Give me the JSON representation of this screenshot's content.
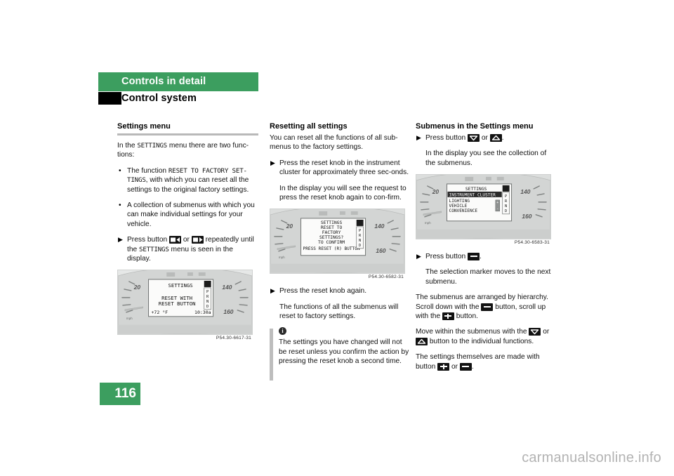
{
  "header": {
    "chapter": "Controls in detail",
    "section": "Control system"
  },
  "page_number": "116",
  "watermark": "carmanualsonline.info",
  "colors": {
    "brand_green": "#3c9e5f",
    "rule_gray": "#b9b9b9",
    "note_bar_gray": "#bdbdbd"
  },
  "columns": {
    "left": {
      "heading": "Settings menu",
      "intro_a": "In the ",
      "intro_code": "SETTINGS",
      "intro_b": " menu there are two func-tions:",
      "bullet1_a": "The function ",
      "bullet1_code": "RESET TO FACTORY SET-TINGS",
      "bullet1_b": ", with which you can reset all the settings to the original factory settings.",
      "bullet2": "A collection of submenus with which you can make individual settings for your vehicle.",
      "step_a": "Press button",
      "step_or": "or",
      "step_b": "repeatedly until the",
      "step_code": "SETTINGS",
      "step_c": "menu is seen in the display.",
      "figure": {
        "caption": "P54.30-6617-31",
        "display_title": "SETTINGS",
        "display_line1": "RESET WITH",
        "display_line2": "RESET BUTTON",
        "temp": "+72 °F",
        "clock": "10:30a",
        "gear_letters": "PRND",
        "left_scale": "20",
        "right_scale_top": "140",
        "right_scale_bottom": "160",
        "unit": "mph"
      }
    },
    "middle": {
      "heading": "Resetting all settings",
      "intro": "You can reset all the functions of all sub-menus to the factory settings.",
      "step1": "Press the reset knob in the instrument cluster for approximately three sec-onds.",
      "step1_result": "In the display you will see the request to press the reset knob again to con-firm.",
      "figure": {
        "caption": "P54.30-6582-31",
        "display_title": "SETTINGS",
        "display_line1": "RESET TO",
        "display_line2": "FACTORY",
        "display_line3": "SETTINGS?",
        "display_line4": "TO CONFIRM",
        "display_line5": "PRESS RESET (R) BUTTON",
        "gear_letters": "PRND",
        "left_scale": "20",
        "right_scale_top": "140",
        "right_scale_bottom": "160",
        "unit": "mph"
      },
      "step2": "Press the reset knob again.",
      "step2_result": "The functions of all the submenus will reset to factory settings.",
      "note_icon": "i",
      "note": "The settings you have changed will not be reset unless you confirm the action by pressing the reset knob a second time."
    },
    "right": {
      "heading": "Submenus in the Settings menu",
      "step1_a": "Press button",
      "step1_or": "or",
      "step1_end": ".",
      "step1_result": "In the display you see the collection of the submenus.",
      "figure": {
        "caption": "P54.30-6583-31",
        "display_title": "SETTINGS",
        "menu_items": [
          "INSTRUMENT CLUSTER",
          "LIGHTING",
          "VEHICLE",
          "CONVENIENCE"
        ],
        "selected_index": 0,
        "gear_letters": "PRND",
        "left_scale": "20",
        "right_scale_top": "140",
        "right_scale_bottom": "160",
        "unit": "mph"
      },
      "step2_a": "Press button",
      "step2_end": ".",
      "step2_result": "The selection marker moves to the next submenu.",
      "para1_a": "The submenus are arranged by hierarchy. Scroll down with the",
      "para1_b": "button, scroll up with the",
      "para1_c": "button.",
      "para2_a": "Move within the submenus with the",
      "para2_or": "or",
      "para2_b": "button to the individual functions.",
      "para3_a": "The settings themselves are made with button",
      "para3_or": "or",
      "para3_end": "."
    }
  }
}
